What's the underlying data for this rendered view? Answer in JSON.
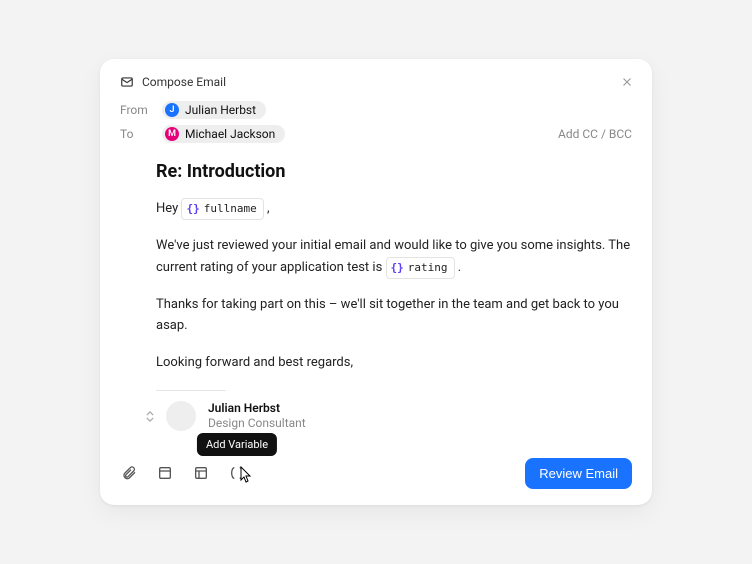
{
  "header": {
    "title": "Compose Email"
  },
  "from": {
    "label": "From",
    "chip": {
      "initial": "J",
      "name": "Julian Herbst"
    }
  },
  "to": {
    "label": "To",
    "chip": {
      "initial": "M",
      "name": "Michael Jackson"
    },
    "ccLabel": "Add CC / BCC"
  },
  "subject": "Re: Introduction",
  "body": {
    "greetingPrefix": "Hey ",
    "var1": "fullname",
    "greetingSuffix": ",",
    "p1a": "We've just reviewed your initial email and would like to give you some insights. The current rating of your application test is ",
    "var2": "rating",
    "p1b": " .",
    "p2": "Thanks for taking part on this – we'll sit together in the team and get back to you asap.",
    "p3": "Looking forward and best regards,"
  },
  "signature": {
    "name": "Julian Herbst",
    "title": "Design Consultant"
  },
  "toolbar": {
    "tooltip": "Add Variable",
    "primary": "Review Email"
  }
}
